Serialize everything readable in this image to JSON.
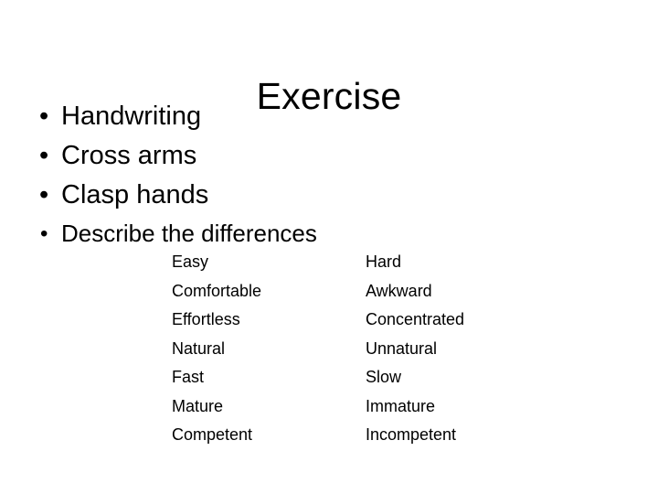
{
  "slide": {
    "title": "Exercise",
    "background_color": "#ffffff",
    "text_color": "#000000",
    "bullets": [
      {
        "text": "Handwriting",
        "level": 1,
        "marker": "bullet-dot"
      },
      {
        "text": "Cross arms",
        "level": 1,
        "marker": "bullet-dot"
      },
      {
        "text": "Clasp hands",
        "level": 1,
        "marker": "bullet-dot"
      },
      {
        "text": "Describe the differences",
        "level": 2,
        "marker": "bullet-dot"
      }
    ],
    "bullet_glyph": "•",
    "pairs": [
      {
        "left": "Easy",
        "right": "Hard"
      },
      {
        "left": "Comfortable",
        "right": "Awkward"
      },
      {
        "left": "Effortless",
        "right": "Concentrated"
      },
      {
        "left": "Natural",
        "right": "Unnatural"
      },
      {
        "left": "Fast",
        "right": "Slow"
      },
      {
        "left": "Mature",
        "right": "Immature"
      },
      {
        "left": "Competent",
        "right": "Incompetent"
      }
    ]
  }
}
